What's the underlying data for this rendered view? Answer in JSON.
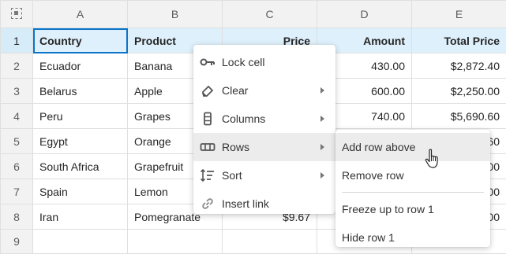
{
  "columns": [
    "A",
    "B",
    "C",
    "D",
    "E"
  ],
  "rows": [
    {
      "num": "1",
      "country": "Country",
      "product": "Product",
      "price": "Price",
      "amount": "Amount",
      "total": "Total Price"
    },
    {
      "num": "2",
      "country": "Ecuador",
      "product": "Banana",
      "price": "",
      "amount": "430.00",
      "total": "$2,872.40"
    },
    {
      "num": "3",
      "country": "Belarus",
      "product": "Apple",
      "price": "",
      "amount": "600.00",
      "total": "$2,250.00"
    },
    {
      "num": "4",
      "country": "Peru",
      "product": "Grapes",
      "price": "",
      "amount": "740.00",
      "total": "$5,690.60"
    },
    {
      "num": "5",
      "country": "Egypt",
      "product": "Orange",
      "price": "",
      "amount": "",
      "total": "60"
    },
    {
      "num": "6",
      "country": "South Africa",
      "product": "Grapefruit",
      "price": "",
      "amount": "",
      "total": "00"
    },
    {
      "num": "7",
      "country": "Spain",
      "product": "Lemon",
      "price": "",
      "amount": "",
      "total": "00"
    },
    {
      "num": "8",
      "country": "Iran",
      "product": "Pomegranate",
      "price": "$9.67",
      "amount": "",
      "total": "00"
    },
    {
      "num": "9",
      "country": "",
      "product": "",
      "price": "",
      "amount": "",
      "total": ""
    }
  ],
  "context_menu": {
    "lock_cell": "Lock cell",
    "clear": "Clear",
    "columns": "Columns",
    "rows": "Rows",
    "sort": "Sort",
    "insert_link": "Insert link"
  },
  "rows_submenu": {
    "add_row_above": "Add row above",
    "remove_row": "Remove row",
    "freeze_up_to_row": "Freeze up to row 1",
    "hide_row": "Hide row 1"
  },
  "colors": {
    "selected_row": "#def0fb",
    "focus_border": "#0b73c7",
    "header_bg": "#f2f2f2",
    "menu_hover": "#ececec"
  }
}
